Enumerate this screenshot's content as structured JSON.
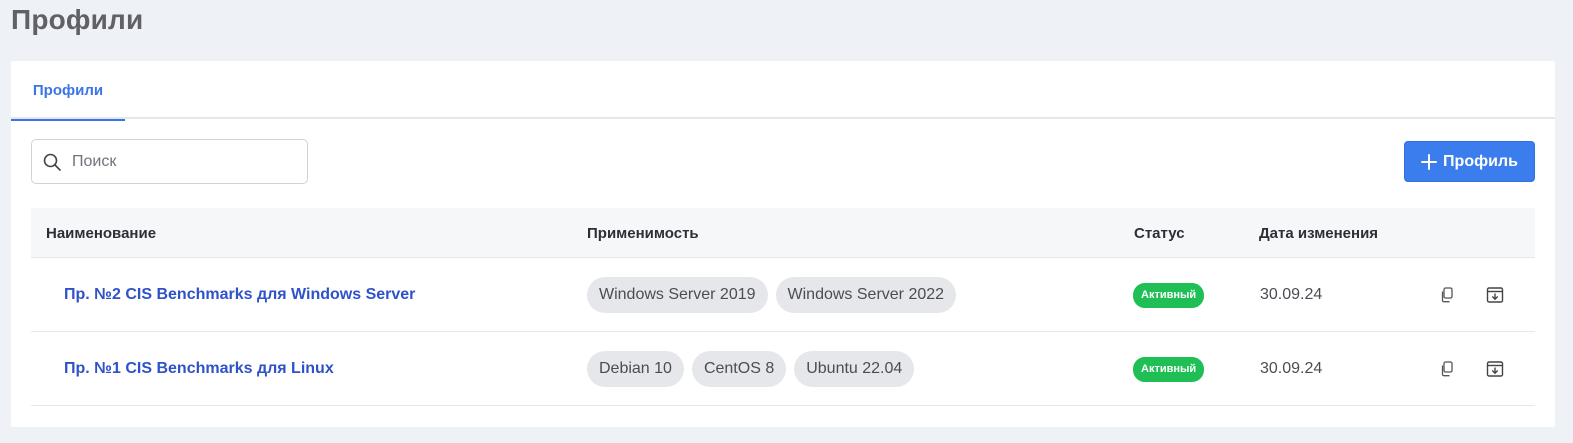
{
  "page": {
    "title": "Профили"
  },
  "tabs": [
    {
      "label": "Профили",
      "active": true
    }
  ],
  "toolbar": {
    "search_placeholder": "Поиск",
    "search_value": "",
    "add_button_label": "Профиль",
    "accent_color": "#3b7ded"
  },
  "table": {
    "columns": [
      "Наименование",
      "Применимость",
      "Статус",
      "Дата изменения"
    ],
    "rows": [
      {
        "name": "Пр. №2 CIS Benchmarks для Windows Server",
        "applicability": [
          "Windows Server 2019",
          "Windows Server 2022"
        ],
        "status": "Активный",
        "date": "30.09.24",
        "actions": [
          "copy-icon",
          "archive-icon"
        ]
      },
      {
        "name": "Пр. №1 CIS Benchmarks для Linux",
        "applicability": [
          "Debian 10",
          "CentOS 8",
          "Ubuntu 22.04"
        ],
        "status": "Активный",
        "date": "30.09.24",
        "actions": [
          "copy-icon",
          "archive-icon"
        ]
      }
    ]
  },
  "colors": {
    "status_active": "#1fbf55",
    "link": "#2f52c9"
  }
}
